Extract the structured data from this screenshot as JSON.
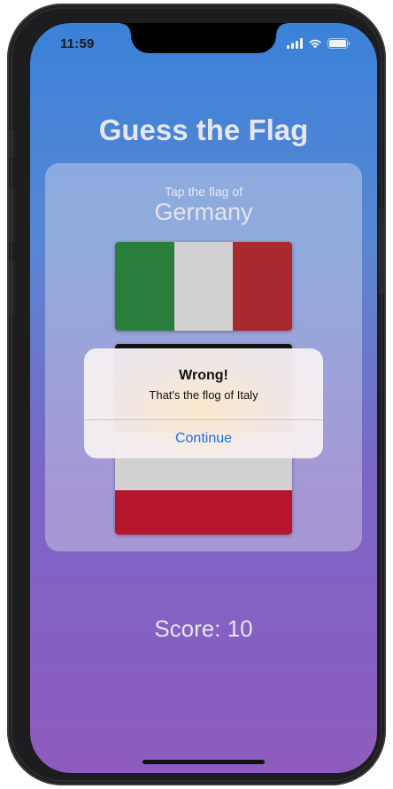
{
  "status_bar": {
    "time": "11:59"
  },
  "app": {
    "title": "Guess the Flag",
    "prompt": "Tap the flag of",
    "country": "Germany",
    "score_text": "Score: 10"
  },
  "flags": [
    {
      "name": "italy",
      "colors": [
        "#2a7e3c",
        "#d1d1d1",
        "#a82a30"
      ]
    },
    {
      "name": "hidden-by-alert",
      "colors": [
        "#111111"
      ]
    },
    {
      "name": "bottom-flag",
      "colors": [
        "#d1d1d1",
        "#b5162e"
      ]
    }
  ],
  "alert": {
    "title": "Wrong!",
    "message": "That's the flog of Italy",
    "button_label": "Continue"
  },
  "colors": {
    "accent": "#1a6fe0",
    "gradient_top": "#3a82d9",
    "gradient_bottom": "#8e5cbe"
  }
}
